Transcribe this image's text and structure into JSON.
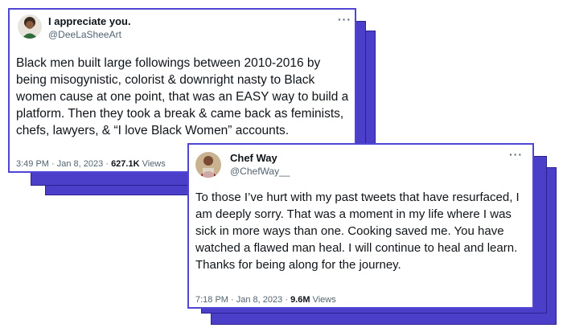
{
  "tweet1": {
    "display_name": "I appreciate you.",
    "handle": "@DeeLaSheeArt",
    "text": "Black men built large followings between 2010-2016 by being misogynistic, colorist & downright nasty to Black women cause at one point, that was an EASY way to build a platform. Then they took a break & came back as feminists, chefs, lawyers, & “I love Black Women” accounts.",
    "time": "3:49 PM",
    "sep": "·",
    "date": "Jan 8, 2023",
    "views_count": "627.1K",
    "views_label": "Views",
    "more_icon": "more-icon"
  },
  "tweet2": {
    "display_name": "Chef Way",
    "handle": "@ChefWay__",
    "text": "To those I’ve hurt with my past tweets that have resurfaced, I am deeply sorry. That was a moment in my life where I was sick in more ways than one. Cooking saved me. You have watched a flawed man heal. I will continue to heal and learn. Thanks for being along for the journey.",
    "time": "7:18 PM",
    "sep": "·",
    "date": "Jan 8, 2023",
    "views_count": "9.6M",
    "views_label": "Views",
    "more_icon": "more-icon"
  },
  "colors": {
    "card_border": "#5046d6",
    "stack": "#4b3fc9",
    "text": "#0f1419",
    "muted": "#536471"
  }
}
